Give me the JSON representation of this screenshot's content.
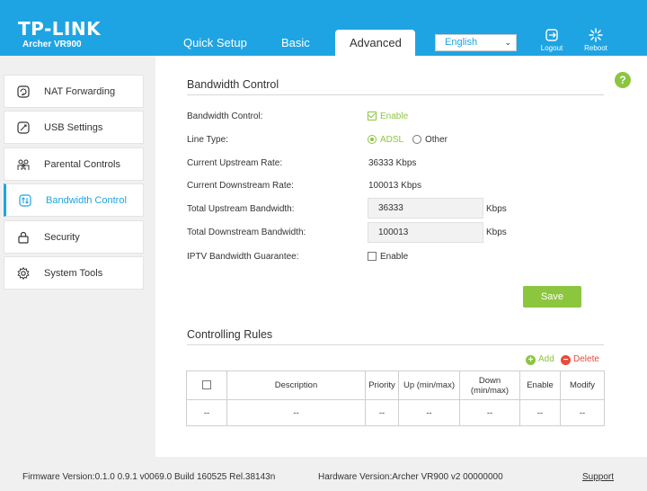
{
  "header": {
    "logo": "TP-LINK",
    "model": "Archer VR900",
    "tabs": [
      {
        "label": "Quick Setup"
      },
      {
        "label": "Basic"
      },
      {
        "label": "Advanced",
        "active": true
      }
    ],
    "language": "English",
    "logout_label": "Logout",
    "reboot_label": "Reboot",
    "accent_color": "#1fa4e3"
  },
  "sidebar": {
    "items": [
      {
        "label": "NAT Forwarding",
        "icon": "nat-forwarding-icon"
      },
      {
        "label": "USB Settings",
        "icon": "usb-icon"
      },
      {
        "label": "Parental Controls",
        "icon": "family-icon"
      },
      {
        "label": "Bandwidth Control",
        "icon": "bandwidth-icon",
        "active": true
      },
      {
        "label": "Security",
        "icon": "lock-icon"
      },
      {
        "label": "System Tools",
        "icon": "gear-icon"
      }
    ]
  },
  "help_label": "?",
  "bandwidth": {
    "title": "Bandwidth Control",
    "control_label": "Bandwidth Control:",
    "control_enable": "Enable",
    "control_checked": true,
    "line_type_label": "Line Type:",
    "line_type_options": [
      "ADSL",
      "Other"
    ],
    "line_type_selected": "ADSL",
    "upstream_rate_label": "Current Upstream Rate:",
    "upstream_rate": "36333 Kbps",
    "downstream_rate_label": "Current Downstream Rate:",
    "downstream_rate": "100013 Kbps",
    "total_up_label": "Total Upstream Bandwidth:",
    "total_up_value": "36333",
    "total_down_label": "Total Downstream Bandwidth:",
    "total_down_value": "100013",
    "unit": "Kbps",
    "iptv_label": "IPTV Bandwidth Guarantee:",
    "iptv_enable": "Enable",
    "iptv_checked": false,
    "save_label": "Save",
    "accent_green": "#8cc63f"
  },
  "rules": {
    "title": "Controlling Rules",
    "add_label": "Add",
    "delete_label": "Delete",
    "columns": [
      "Description",
      "Priority",
      "Up (min/max)",
      "Down (min/max)",
      "Enable",
      "Modify"
    ],
    "empty_row": [
      "--",
      "--",
      "--",
      "--",
      "--",
      "--",
      "--"
    ]
  },
  "footer": {
    "firmware": "Firmware Version:0.1.0 0.9.1 v0069.0 Build 160525 Rel.38143n",
    "hardware": "Hardware Version:Archer VR900 v2 00000000",
    "support": "Support"
  }
}
